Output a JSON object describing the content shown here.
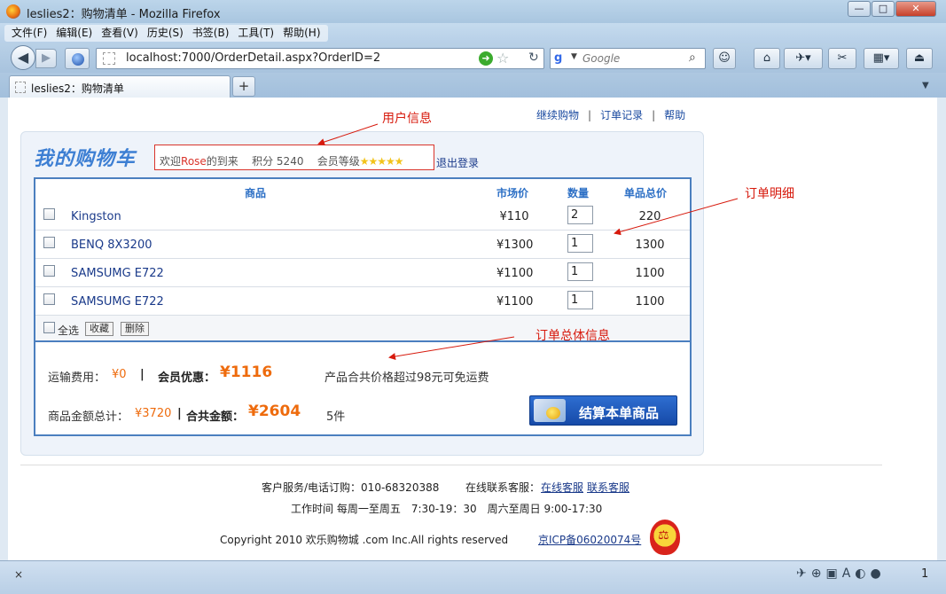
{
  "window": {
    "title": "leslies2：购物清单 - Mozilla Firefox",
    "min": "—",
    "max": "□",
    "close": "✕"
  },
  "menu": [
    "文件(F)",
    "编辑(E)",
    "查看(V)",
    "历史(S)",
    "书签(B)",
    "工具(T)",
    "帮助(H)"
  ],
  "nav": {
    "url": "localhost:7000/OrderDetail.aspx?OrderID=2",
    "search_placeholder": "Google"
  },
  "tab": {
    "label": "leslies2：购物清单"
  },
  "page": {
    "top_links": [
      "继续购物",
      "订单记录",
      "帮助"
    ],
    "cart_title": "我的购物车",
    "welcome_prefix": "欢迎",
    "username": "Rose",
    "welcome_suffix": "的到来",
    "points_label": "积分",
    "points": "5240",
    "level_label": "会员等级",
    "level_stars": "★★★★★",
    "logout": "退出登录",
    "columns": {
      "product": "商品",
      "market_price": "市场价",
      "quantity": "数量",
      "subtotal": "单品总价"
    },
    "items": [
      {
        "name": "Kingston",
        "price": "¥110",
        "qty": "2",
        "subtotal": "220"
      },
      {
        "name": "BENQ 8X3200",
        "price": "¥1300",
        "qty": "1",
        "subtotal": "1300"
      },
      {
        "name": "SAMSUMG E722",
        "price": "¥1100",
        "qty": "1",
        "subtotal": "1100"
      },
      {
        "name": "SAMSUMG E722",
        "price": "¥1100",
        "qty": "1",
        "subtotal": "1100"
      }
    ],
    "select_all": "全选",
    "favorite_btn": "收藏",
    "delete_btn": "删除",
    "shipping_label": "运输费用：",
    "shipping_value": "¥0",
    "discount_label": "会员优惠：",
    "discount_value": "¥1116",
    "free_shipping_note": "产品合共价格超过98元可免运费",
    "goods_total_label": "商品金额总计：",
    "goods_total_value": "¥3720",
    "grand_total_label": "合共金额：",
    "grand_total_value": "¥2604",
    "item_count": "5件",
    "checkout_btn": "结算本单商品",
    "sep": "|"
  },
  "footer": {
    "line1_prefix": "客户服务/电话订购：010-68320388",
    "line1_online": "在线联系客服：",
    "online_link": "在线客服",
    "contact_link": "联系客服",
    "line2": "工作时间 每周一至周五　7:30-19：30　周六至周日 9:00-17:30",
    "copyright": "Copyright 2010 欢乐购物城 .com Inc.All rights reserved",
    "icp": "京ICP备06020074号"
  },
  "annotations": {
    "user_info": "用户信息",
    "order_detail": "订单明细",
    "order_summary": "订单总体信息"
  },
  "status": {
    "close": "×",
    "count": "1"
  },
  "colors": {
    "accent_blue": "#2c6fc5",
    "price_orange": "#ee6b0d",
    "annotation_red": "#d71a0d"
  }
}
